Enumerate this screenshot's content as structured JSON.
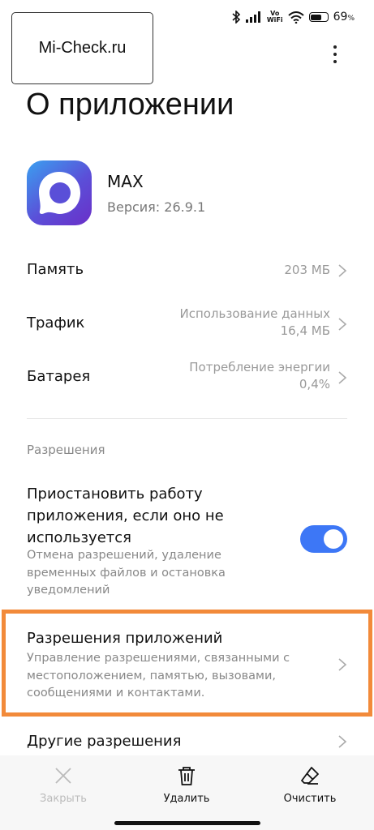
{
  "status_bar": {
    "battery_percent": "69",
    "battery_unit": "%",
    "vowifi_line1": "Vo",
    "vowifi_line2": "WiFi",
    "battery_level": 0.69,
    "icons": [
      "bluetooth-icon",
      "signal-icon",
      "vowifi-icon",
      "wifi-icon",
      "battery-icon"
    ]
  },
  "watermark": {
    "text": "Mi-Check.ru"
  },
  "header": {
    "title": "О приложении",
    "menu_icon": "more-vertical-icon"
  },
  "app": {
    "name": "MAX",
    "version": "Версия: 26.9.1"
  },
  "info_rows": [
    {
      "label": "Память",
      "value_line1": "203 МБ",
      "value_line2": ""
    },
    {
      "label": "Трафик",
      "value_line1": "Использование данных",
      "value_line2": "16,4 МБ"
    },
    {
      "label": "Батарея",
      "value_line1": "Потребление энергии",
      "value_line2": "0,4%"
    }
  ],
  "permissions": {
    "section_title": "Разрешения",
    "pause_title": "Приостановить работу приложения, если оно не используется",
    "pause_subtitle": "Отмена разрешений, удаление временных файлов и остановка уведомлений",
    "pause_enabled": true,
    "app_permissions_title": "Разрешения приложений",
    "app_permissions_subtitle": "Управление разрешениями, связанными с местоположением, памятью, вызовами, сообщениями и контактами.",
    "other_permissions_title": "Другие разрешения"
  },
  "colors": {
    "accent": "#3d77f6",
    "highlight": "#f28a3a"
  },
  "bottom_bar": {
    "close": {
      "label": "Закрыть",
      "icon": "close-icon",
      "enabled": false
    },
    "delete": {
      "label": "Удалить",
      "icon": "trash-icon",
      "enabled": true
    },
    "clear": {
      "label": "Очистить",
      "icon": "eraser-icon",
      "enabled": true
    }
  }
}
